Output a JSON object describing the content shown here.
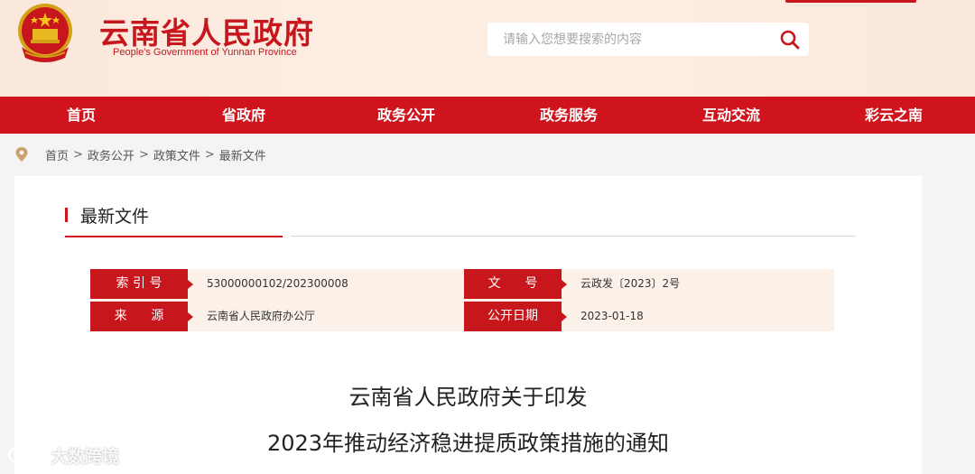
{
  "header": {
    "site_title": "云南省人民政府",
    "site_subtitle": "People's Government of Yunnan Province",
    "search": {
      "placeholder": "请输入您想要搜索的内容"
    }
  },
  "nav": {
    "items": [
      {
        "label": "首页"
      },
      {
        "label": "省政府"
      },
      {
        "label": "政务公开"
      },
      {
        "label": "政务服务"
      },
      {
        "label": "互动交流"
      },
      {
        "label": "彩云之南"
      }
    ]
  },
  "breadcrumb": {
    "items": [
      "首页",
      "政务公开",
      "政策文件",
      "最新文件"
    ],
    "separator": ">"
  },
  "section": {
    "title": "最新文件"
  },
  "meta": {
    "index_label": "索 引 号",
    "index_value": "53000000102/202300008",
    "doc_no_label": "文      号",
    "doc_no_value": "云政发〔2023〕2号",
    "source_label": "来      源",
    "source_value": "云南省人民政府办公厅",
    "date_label": "公开日期",
    "date_value": "2023-01-18"
  },
  "document": {
    "title_line1": "云南省人民政府关于印发",
    "title_line2": "2023年推动经济稳进提质政策措施的通知"
  },
  "watermark": {
    "text": "大数跨境"
  },
  "colors": {
    "brand_red": "#d0141e",
    "header_bg": "#fbe8dc",
    "meta_bg": "#fbf1e8"
  }
}
